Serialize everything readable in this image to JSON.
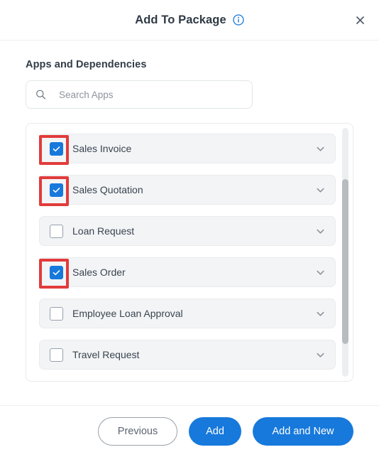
{
  "dialog": {
    "title": "Add To Package",
    "info_icon": "info-circle-icon",
    "close_icon": "close-icon"
  },
  "body": {
    "section_label": "Apps and Dependencies",
    "search": {
      "icon": "search-icon",
      "placeholder": "Search Apps",
      "value": ""
    },
    "apps": [
      {
        "label": "Sales Invoice",
        "checked": true,
        "highlighted": true,
        "expand_icon": "chevron-down-icon"
      },
      {
        "label": "Sales Quotation",
        "checked": true,
        "highlighted": true,
        "expand_icon": "chevron-down-icon"
      },
      {
        "label": "Loan Request",
        "checked": false,
        "highlighted": false,
        "expand_icon": "chevron-down-icon"
      },
      {
        "label": "Sales Order",
        "checked": true,
        "highlighted": true,
        "expand_icon": "chevron-down-icon"
      },
      {
        "label": "Employee Loan Approval",
        "checked": false,
        "highlighted": false,
        "expand_icon": "chevron-down-icon"
      },
      {
        "label": "Travel Request",
        "checked": false,
        "highlighted": false,
        "expand_icon": "chevron-down-icon"
      }
    ]
  },
  "footer": {
    "previous_label": "Previous",
    "add_label": "Add",
    "add_and_new_label": "Add and New"
  },
  "colors": {
    "accent_blue": "#1779db",
    "annotation_red": "#e23b3b",
    "row_background": "#f3f4f6",
    "text_primary": "#39444f"
  }
}
